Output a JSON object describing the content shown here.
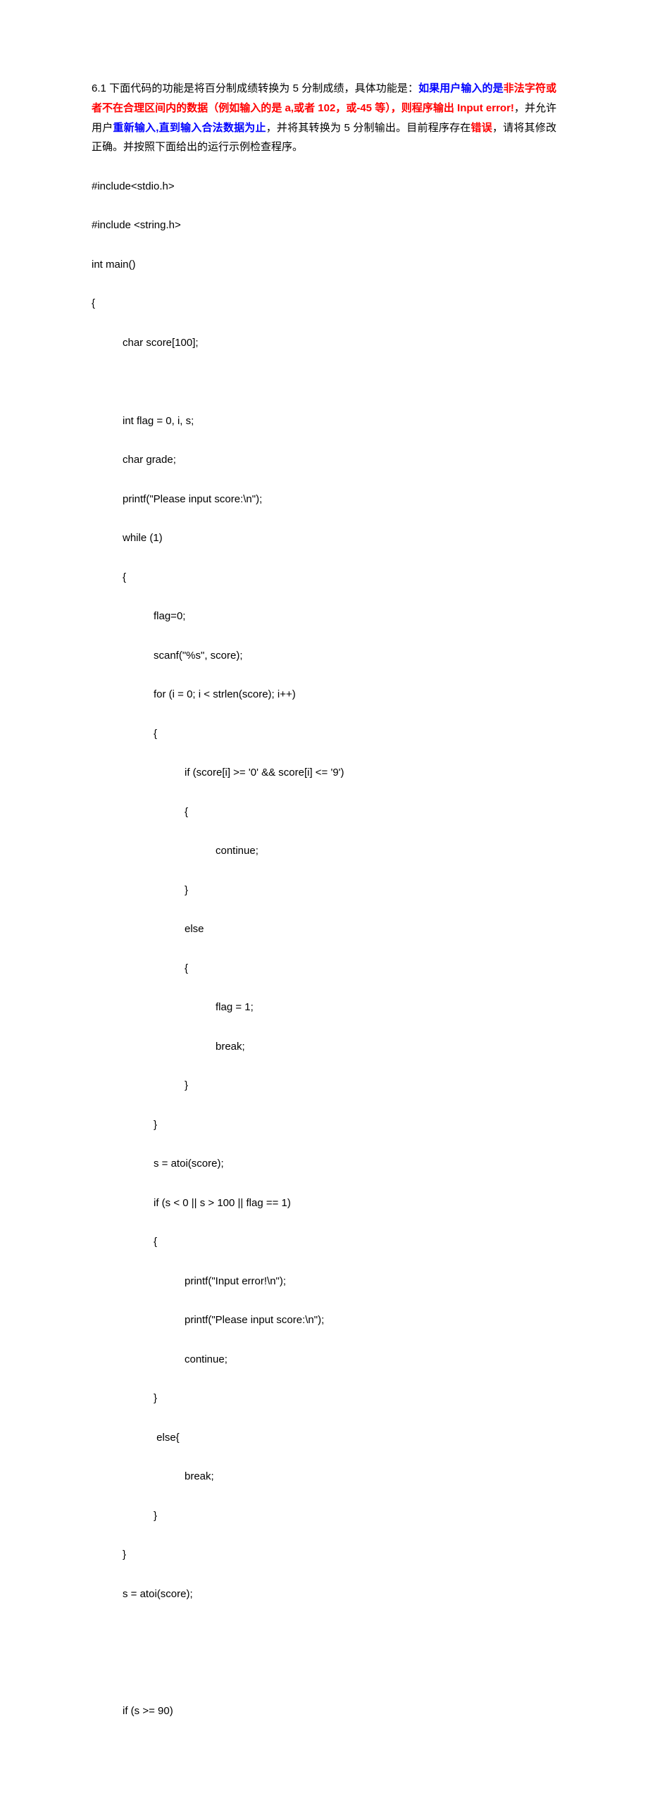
{
  "intro": {
    "t1": "6.1  下面代码的功能是将百分制成绩转换为 5 分制成绩，具体功能是：",
    "t2": "如果用户输入的是",
    "t3": "非法字符或者不在合理区间内的数据（例如输入的是 a,或者 102，或-45 等），则程序输出 Input error!",
    "t4": "，并允许用户",
    "t5": "重新输入,直到输入合法数据为止",
    "t6": "，并将其转换为 5 分制输出。目前程序存在",
    "t7": "错误",
    "t8": "，请将其修改正确。并按照下面给出的运行示例检查程序。"
  },
  "code": {
    "l1": "#include<stdio.h>",
    "l2": "#include <string.h>",
    "l3": "int main()",
    "l4": "{",
    "l5": "char score[100];",
    "l6": "int flag = 0, i, s;",
    "l7": "char grade;",
    "l8": "printf(\"Please input score:\\n\");",
    "l9": "while (1)",
    "l10": "{",
    "l11": "flag=0;",
    "l12": "scanf(\"%s\", score);",
    "l13": "for (i = 0; i < strlen(score); i++)",
    "l14": "{",
    "l15": "if (score[i] >= '0' && score[i] <= '9')",
    "l16": "{",
    "l17": "continue;",
    "l18": "}",
    "l19": "else",
    "l20": "{",
    "l21": "flag = 1;",
    "l22": "break;",
    "l23": "}",
    "l24": "}",
    "l25": "s = atoi(score);",
    "l26": "if (s < 0 || s > 100 || flag == 1)",
    "l27": "{",
    "l28": "printf(\"Input error!\\n\");",
    "l29": "printf(\"Please input score:\\n\");",
    "l30": "continue;",
    "l31": "}",
    "l32": " else{",
    "l33": "break;",
    "l34": "}",
    "l35": "}",
    "l36": "s = atoi(score);",
    "l37": "if (s >= 90)"
  }
}
